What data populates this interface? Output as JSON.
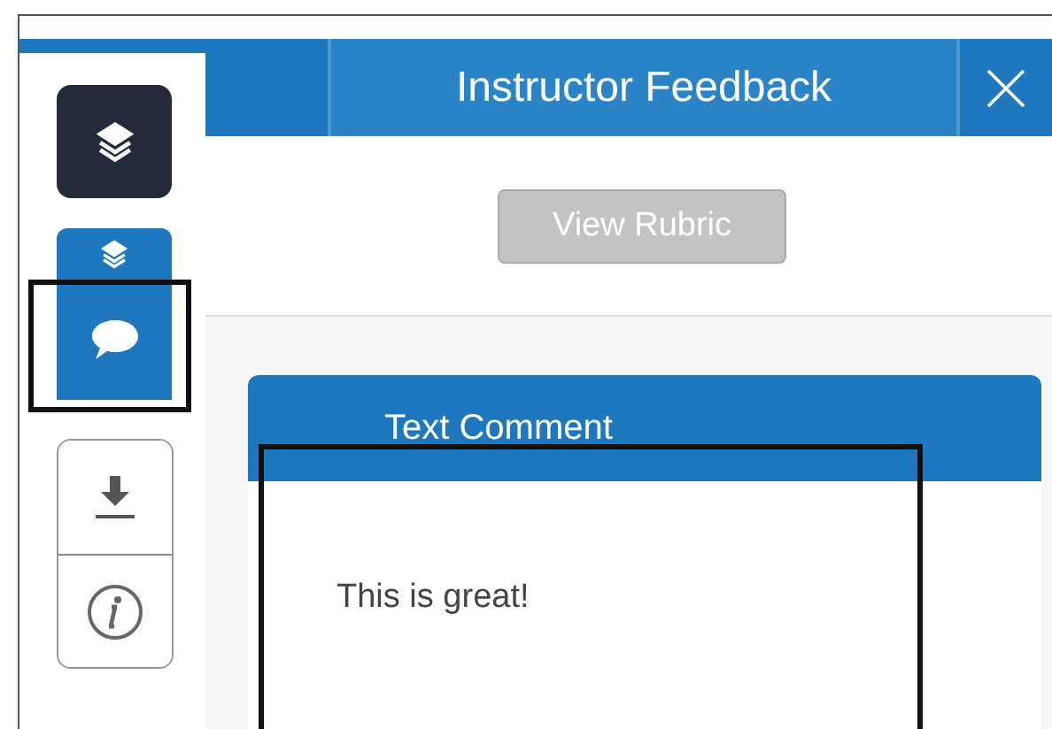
{
  "panel": {
    "title": "Instructor Feedback"
  },
  "tools": [
    {
      "kind": "layers",
      "selected": false
    },
    {
      "kind": "comments",
      "selected": true
    }
  ],
  "actions": [
    {
      "kind": "download"
    },
    {
      "kind": "info"
    }
  ],
  "rubric_button": {
    "label": "View Rubric",
    "disabled": true
  },
  "comment": {
    "title": "Text Comment",
    "text": "This is great!"
  }
}
